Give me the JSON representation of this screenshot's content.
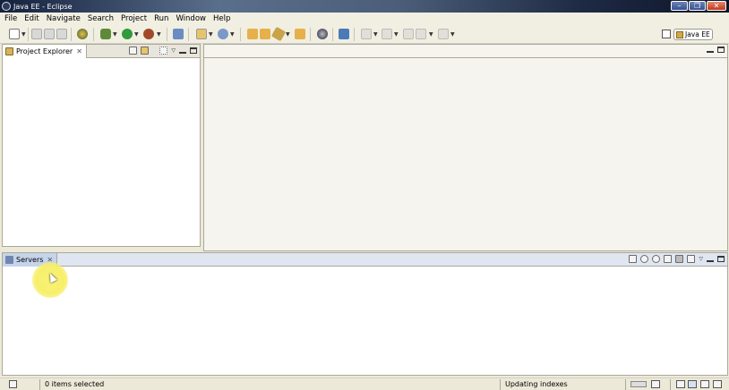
{
  "window": {
    "title": "Java EE - Eclipse"
  },
  "menubar": {
    "items": [
      "File",
      "Edit",
      "Navigate",
      "Search",
      "Project",
      "Run",
      "Window",
      "Help"
    ]
  },
  "perspective": {
    "label": "Java EE"
  },
  "views": {
    "project_explorer": {
      "label": "Project Explorer"
    },
    "servers": {
      "label": "Servers"
    }
  },
  "status": {
    "selection": "0 items selected",
    "progress": "Updating indexes"
  },
  "icons": {
    "app": "eclipse-logo-icon",
    "new": "new-wizard-icon",
    "save": "save-icon",
    "debug": "debug-icon",
    "run": "run-icon",
    "perspective": "java-ee-perspective-icon"
  }
}
